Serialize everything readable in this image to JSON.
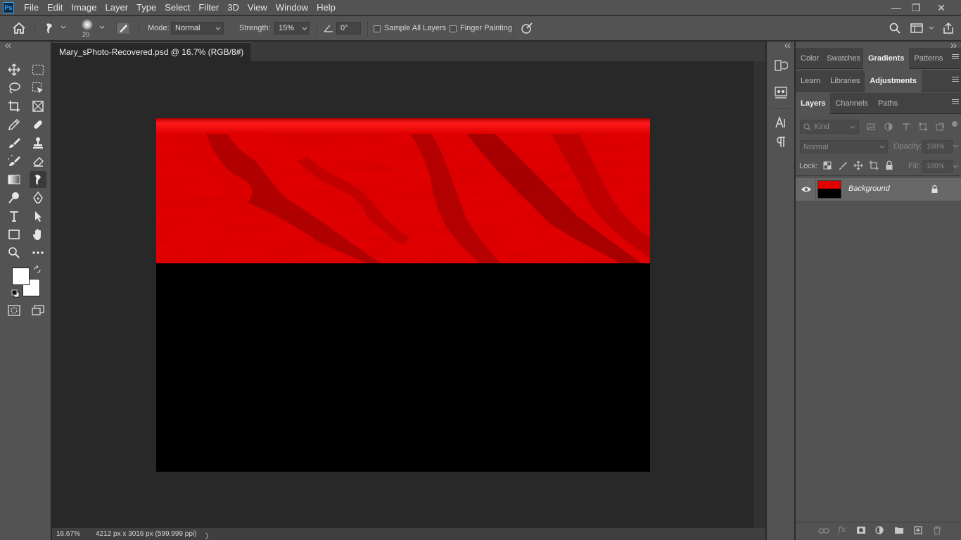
{
  "app": {
    "logo": "Ps"
  },
  "menu": [
    "File",
    "Edit",
    "Image",
    "Layer",
    "Type",
    "Select",
    "Filter",
    "3D",
    "View",
    "Window",
    "Help"
  ],
  "window_controls": {
    "minimize": "—",
    "restore": "❐",
    "close": "✕"
  },
  "options": {
    "brush_size": "20",
    "mode_label": "Mode:",
    "mode_value": "Normal",
    "strength_label": "Strength:",
    "strength_value": "15%",
    "angle_value": "0°",
    "sample_all_layers": "Sample All Layers",
    "finger_painting": "Finger Painting"
  },
  "document": {
    "tab_title": "Mary_sPhoto-Recovered.psd @ 16.7% (RGB/8#)",
    "close_glyph": "×"
  },
  "status": {
    "zoom": "16.67%",
    "info": "4212 px x 3016 px (599.999 ppi)",
    "arrow": "〉"
  },
  "panels": {
    "group1_tabs": [
      "Color",
      "Swatches",
      "Gradients",
      "Patterns"
    ],
    "group1_active": "Gradients",
    "group2_tabs": [
      "Learn",
      "Libraries",
      "Adjustments"
    ],
    "group2_active": "Adjustments",
    "group3_tabs": [
      "Layers",
      "Channels",
      "Paths"
    ],
    "group3_active": "Layers",
    "layers": {
      "filter_placeholder": "Kind",
      "blend_mode": "Normal",
      "opacity_label": "Opacity:",
      "opacity_value": "100%",
      "lock_label": "Lock:",
      "fill_label": "Fill:",
      "fill_value": "100%",
      "items": [
        {
          "name": "Background",
          "visible": true,
          "locked": true
        }
      ]
    }
  },
  "colors": {
    "ui_bg": "#535353",
    "canvas_bg": "#282828",
    "image_red": "#e00000",
    "image_black": "#000000",
    "foreground": "#ffffff",
    "background": "#ffffff"
  }
}
